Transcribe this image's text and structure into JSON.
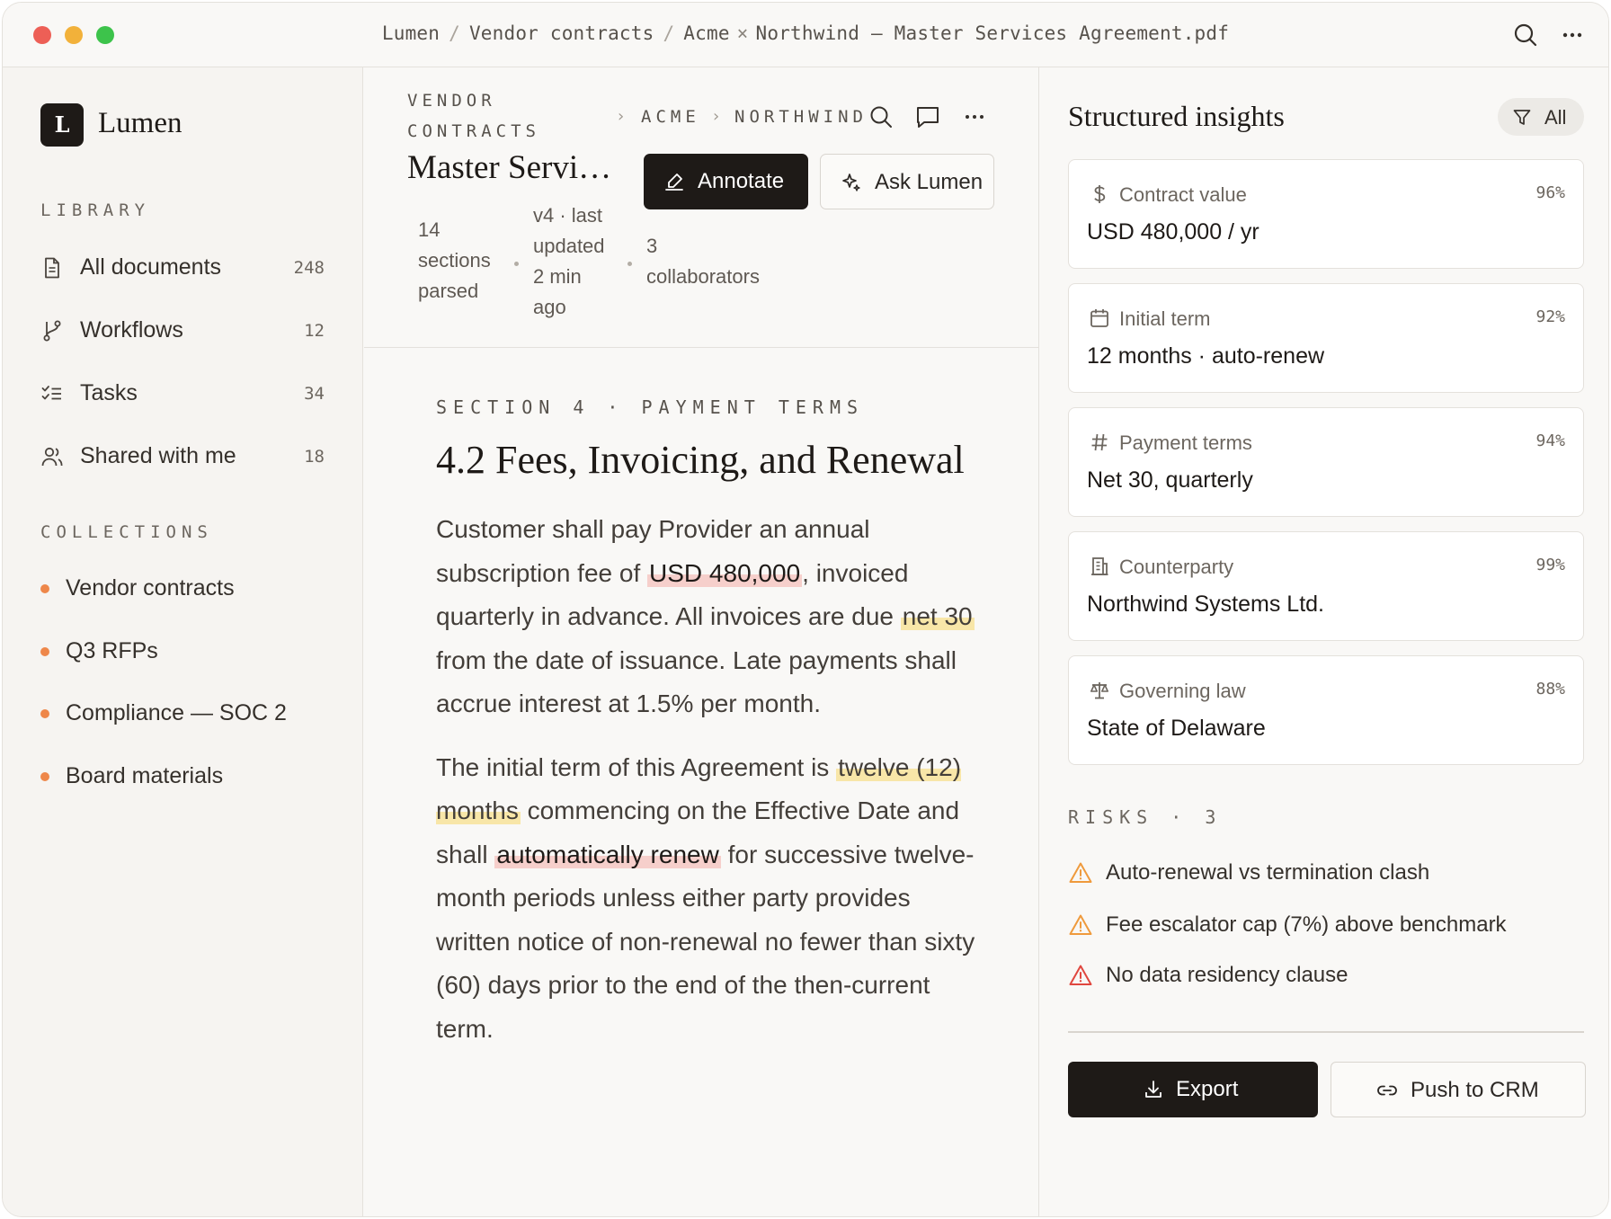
{
  "window": {
    "breadcrumb": [
      "Lumen",
      "Vendor contracts",
      "Acme",
      "Northwind — Master Services Agreement.pdf"
    ],
    "crumb_separator": "/",
    "crumb_x": "×"
  },
  "sidebar": {
    "logo_letter": "L",
    "brand": "Lumen",
    "library_label": "LIBRARY",
    "library": [
      {
        "label": "All documents",
        "count": "248",
        "icon": "document-icon"
      },
      {
        "label": "Workflows",
        "count": "12",
        "icon": "branch-icon"
      },
      {
        "label": "Tasks",
        "count": "34",
        "icon": "checklist-icon"
      },
      {
        "label": "Shared with me",
        "count": "18",
        "icon": "users-icon"
      }
    ],
    "collections_label": "COLLECTIONS",
    "collections": [
      {
        "label": "Vendor contracts"
      },
      {
        "label": "Q3 RFPs"
      },
      {
        "label": "Compliance — SOC 2"
      },
      {
        "label": "Board materials"
      }
    ],
    "collection_dot_color": "#ee874a"
  },
  "document": {
    "crumbs": [
      "VENDOR",
      "CONTRACTS",
      "ACME",
      "NORTHWIND"
    ],
    "title": "Master Services Agreement",
    "annotate_label": "Annotate",
    "ask_label": "Ask Lumen",
    "meta": {
      "sections": [
        "14",
        "sections",
        "parsed"
      ],
      "version": [
        "v4 · last",
        "updated",
        "2 min",
        "ago"
      ],
      "collaborators": [
        "3",
        "collaborators"
      ]
    },
    "section_eyebrow": "SECTION 4 · PAYMENT TERMS",
    "section_title": "4.2 Fees, Invoicing, and Renewal",
    "para1": {
      "a": "Customer shall pay Provider an annual subscription fee of ",
      "hl1": "USD 480,000",
      "b": ", invoiced quarterly in advance. All invoices are due ",
      "hl2": "net 30",
      "c": " from the date of issuance. Late payments shall accrue interest at 1.5% per month."
    },
    "para2": {
      "a": "The initial term of this Agreement is ",
      "hl1": "twelve (12) months",
      "b": " commencing on the Effective Date and shall ",
      "hl2": "automatically renew",
      "c": " for successive twelve-month periods unless either party provides written notice of non-renewal no fewer than sixty (60) days prior to the end of the then-current term."
    },
    "highlight_colors": {
      "risk": "#f6cfcb",
      "note": "#f8e6a8"
    }
  },
  "insights": {
    "title": "Structured insights",
    "filter_label": "All",
    "cards": [
      {
        "label": "Contract value",
        "pct": "96%",
        "value": "USD 480,000 / yr",
        "icon": "dollar-icon"
      },
      {
        "label": "Initial term",
        "pct": "92%",
        "value": "12 months · auto-renew",
        "icon": "calendar-icon"
      },
      {
        "label": "Payment terms",
        "pct": "94%",
        "value": "Net 30, quarterly",
        "icon": "hash-icon"
      },
      {
        "label": "Counterparty",
        "pct": "99%",
        "value": "Northwind Systems Ltd.",
        "icon": "building-icon"
      },
      {
        "label": "Governing law",
        "pct": "88%",
        "value": "State of Delaware",
        "icon": "scale-icon"
      }
    ],
    "risks_label": "RISKS · 3",
    "risks": [
      {
        "label": "Auto-renewal vs termination clash",
        "severity": "warning",
        "color": "#ef9a3c"
      },
      {
        "label": "Fee escalator cap (7%) above benchmark",
        "severity": "warning",
        "color": "#ef9a3c"
      },
      {
        "label": "No data residency clause",
        "severity": "critical",
        "color": "#e0473f"
      }
    ],
    "export_label": "Export",
    "crm_label": "Push to CRM"
  }
}
